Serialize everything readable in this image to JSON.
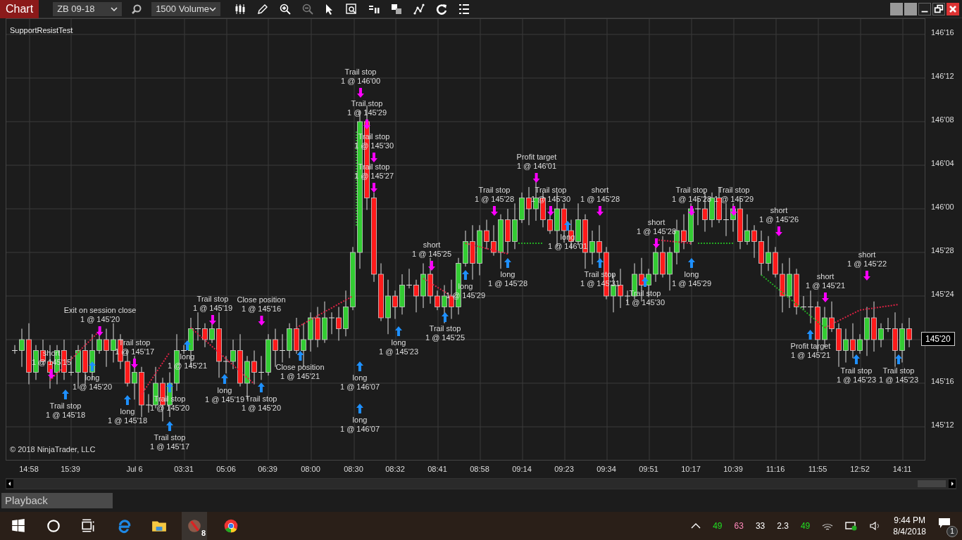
{
  "toolbar": {
    "title": "Chart",
    "instrument": "ZB 09-18",
    "bar_type": "1500 Volume"
  },
  "chart": {
    "strategy_name": "SupportResistTest",
    "copyright": "© 2018 NinjaTrader, LLC",
    "current_price": "145'20",
    "price_ticks": [
      "146'16",
      "146'12",
      "146'08",
      "146'04",
      "146'00",
      "145'28",
      "145'24",
      "145'16",
      "145'12"
    ],
    "time_labels": [
      "14:58",
      "15:39",
      "Jul 6",
      "03:31",
      "05:06",
      "06:39",
      "08:00",
      "08:30",
      "08:32",
      "08:41",
      "08:58",
      "09:14",
      "09:23",
      "09:34",
      "09:51",
      "10:17",
      "10:39",
      "11:16",
      "11:55",
      "12:52",
      "14:11"
    ],
    "trade_markers": [
      {
        "kind": "sell",
        "action": "Trail stop",
        "fill": "1 @ 146'00"
      },
      {
        "kind": "sell",
        "action": "Trail stop",
        "fill": "1 @ 145'29"
      },
      {
        "kind": "sell",
        "action": "Trail stop",
        "fill": "1 @ 145'30"
      },
      {
        "kind": "sell",
        "action": "Profit target",
        "fill": "1 @ 146'01"
      },
      {
        "kind": "sell",
        "action": "Trail stop",
        "fill": "1 @ 145'27"
      },
      {
        "kind": "sell",
        "action": "Trail stop",
        "fill": "1 @ 145'28"
      },
      {
        "kind": "sell",
        "action": "Trail stop",
        "fill": "1 @ 145'30"
      },
      {
        "kind": "sell",
        "action": "short",
        "fill": "1 @ 145'28"
      },
      {
        "kind": "sell",
        "action": "Trail stop",
        "fill": "1 @ 145'28"
      },
      {
        "kind": "sell",
        "action": "Trail stop",
        "fill": "1 @ 145'29"
      },
      {
        "kind": "sell",
        "action": "short",
        "fill": "1 @ 145'26"
      },
      {
        "kind": "sell",
        "action": "short",
        "fill": "1 @ 145'28"
      },
      {
        "kind": "buy",
        "action": "long",
        "fill": "1 @ 146'01"
      },
      {
        "kind": "sell",
        "action": "short",
        "fill": "1 @ 145'25"
      },
      {
        "kind": "sell",
        "action": "short",
        "fill": "1 @ 145'22"
      },
      {
        "kind": "buy",
        "action": "long",
        "fill": "1 @ 145'28"
      },
      {
        "kind": "buy",
        "action": "Trail stop",
        "fill": "1 @ 145'31"
      },
      {
        "kind": "buy",
        "action": "long",
        "fill": "1 @ 145'29"
      },
      {
        "kind": "buy",
        "action": "long",
        "fill": "1 @ 145'29"
      },
      {
        "kind": "sell",
        "action": "short",
        "fill": "1 @ 145'21"
      },
      {
        "kind": "buy",
        "action": "Trail stop",
        "fill": "1 @ 145'30"
      },
      {
        "kind": "sell",
        "action": "Trail stop",
        "fill": "1 @ 145'19"
      },
      {
        "kind": "sell",
        "action": "Close position",
        "fill": "1 @ 145'16"
      },
      {
        "kind": "sell",
        "action": "Exit on session close",
        "fill": "1 @ 145'20"
      },
      {
        "kind": "buy",
        "action": "Trail stop",
        "fill": "1 @ 145'25"
      },
      {
        "kind": "buy",
        "action": "long",
        "fill": "1 @ 145'23"
      },
      {
        "kind": "buy",
        "action": "Profit target",
        "fill": "1 @ 145'21"
      },
      {
        "kind": "sell",
        "action": "short",
        "fill": "1 @ 145'15"
      },
      {
        "kind": "sell",
        "action": "Trail stop",
        "fill": "1 @ 145'17"
      },
      {
        "kind": "buy",
        "action": "long",
        "fill": "1 @ 145'21"
      },
      {
        "kind": "buy",
        "action": "Close position",
        "fill": "1 @ 145'21"
      },
      {
        "kind": "buy",
        "action": "Trail stop",
        "fill": "1 @ 145'23"
      },
      {
        "kind": "buy",
        "action": "Trail stop",
        "fill": "1 @ 145'23"
      },
      {
        "kind": "buy",
        "action": "long",
        "fill": "1 @ 145'20"
      },
      {
        "kind": "buy",
        "action": "long",
        "fill": "1 @ 146'07"
      },
      {
        "kind": "buy",
        "action": "long",
        "fill": "1 @ 145'19"
      },
      {
        "kind": "buy",
        "action": "Trail stop",
        "fill": "1 @ 145'20"
      },
      {
        "kind": "buy",
        "action": "Trail stop",
        "fill": "1 @ 145'20"
      },
      {
        "kind": "buy",
        "action": "Trail stop",
        "fill": "1 @ 145'18"
      },
      {
        "kind": "buy",
        "action": "long",
        "fill": "1 @ 145'18"
      },
      {
        "kind": "buy",
        "action": "long",
        "fill": "1 @ 146'07"
      },
      {
        "kind": "buy",
        "action": "Trail stop",
        "fill": "1 @ 145'17"
      }
    ]
  },
  "status_tab": "Playback",
  "taskbar": {
    "app_badge": "8",
    "tray_readings": [
      {
        "text": "49",
        "color": "#22dd22"
      },
      {
        "text": "63",
        "color": "#ff88bb"
      },
      {
        "text": "33",
        "color": "#ffffff"
      },
      {
        "text": "2.3",
        "color": "#ffffff"
      },
      {
        "text": "49",
        "color": "#22dd22"
      }
    ],
    "time": "9:44 PM",
    "date": "8/4/2018",
    "notification_count": "1"
  }
}
